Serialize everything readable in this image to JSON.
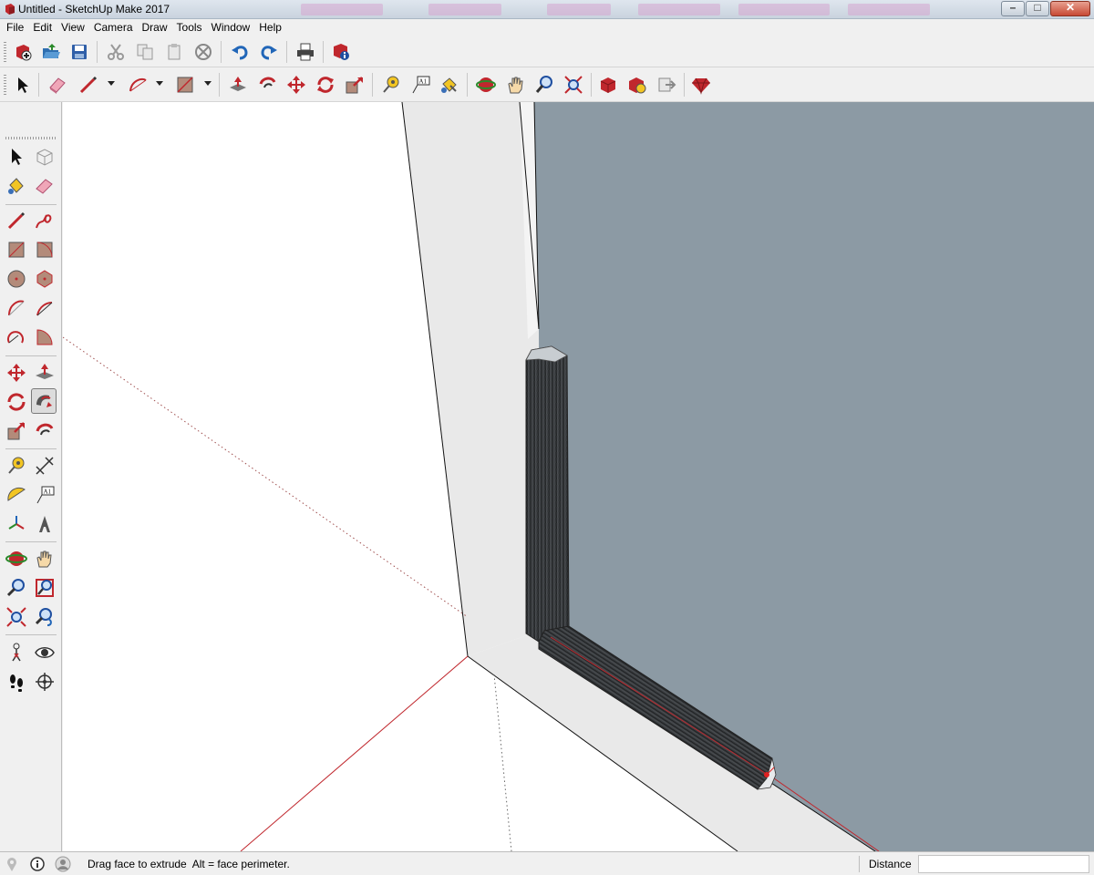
{
  "window": {
    "title": "Untitled - SketchUp Make 2017"
  },
  "menu": [
    "File",
    "Edit",
    "View",
    "Camera",
    "Draw",
    "Tools",
    "Window",
    "Help"
  ],
  "toolbar_standard": [
    "new-icon",
    "open-icon",
    "save-icon",
    "cut-icon",
    "copy-icon",
    "paste-icon",
    "erase-icon",
    "undo-icon",
    "redo-icon",
    "print-icon",
    "model-info-icon"
  ],
  "toolbar_getting_started": [
    "select-icon",
    "eraser-icon",
    "line-icon",
    "arc-icon",
    "rectangle-icon",
    "push-pull-icon",
    "offset-icon",
    "move-icon",
    "rotate-icon",
    "scale-icon",
    "tape-measure-icon",
    "text-icon",
    "paint-bucket-icon",
    "orbit-icon",
    "pan-icon",
    "zoom-icon",
    "zoom-extents-icon",
    "3d-warehouse-icon",
    "extension-warehouse-icon",
    "layout-icon",
    "ruby-icon"
  ],
  "palette_active_tool": "follow-me-icon",
  "status": {
    "hint": "Drag face to extrude  Alt = face perimeter.",
    "measurement_label": "Distance",
    "measurement_value": ""
  }
}
